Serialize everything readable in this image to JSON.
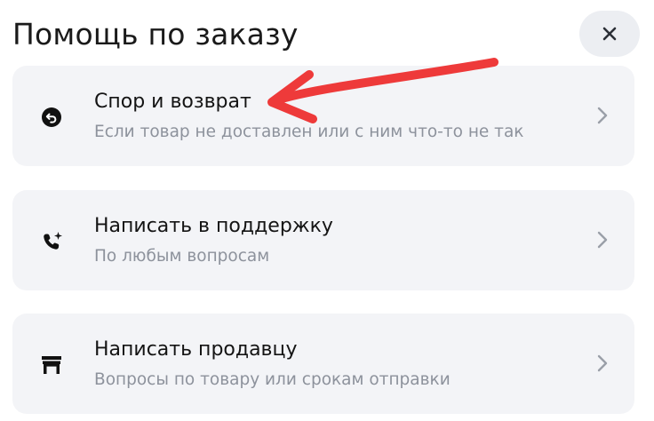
{
  "header": {
    "title": "Помощь по заказу",
    "close_icon": "close-icon"
  },
  "options": [
    {
      "title": "Спор и возврат",
      "subtitle": "Если товар не доставлен или с ним что-то не так",
      "icon": "return-arrow-icon"
    },
    {
      "title": "Написать в поддержку",
      "subtitle": "По любым вопросам",
      "icon": "support-phone-icon"
    },
    {
      "title": "Написать продавцу",
      "subtitle": "Вопросы по товару или срокам отправки",
      "icon": "store-icon"
    }
  ],
  "annotation": {
    "icon": "red-arrow-annotation",
    "color": "#ee3a3a"
  },
  "colors": {
    "card_background": "#f3f4f7",
    "close_background": "#eceef2",
    "subtitle": "#8d929c"
  }
}
